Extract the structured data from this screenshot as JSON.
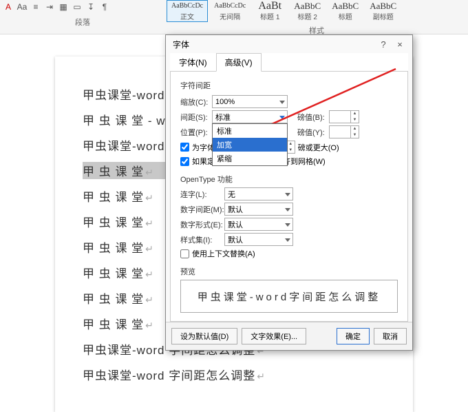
{
  "ribbon": {
    "paragraph_label": "段落",
    "styles_label": "样式",
    "styles": [
      {
        "preview": "AaBbCcDc",
        "name": "正文",
        "size": "10px"
      },
      {
        "preview": "AaBbCcDc",
        "name": "无间隔",
        "size": "10px"
      },
      {
        "preview": "AaBt",
        "name": "标题 1",
        "size": "16px"
      },
      {
        "preview": "AaBbC",
        "name": "标题 2",
        "size": "13px"
      },
      {
        "preview": "AaBbC",
        "name": "标题",
        "size": "13px"
      },
      {
        "preview": "AaBbC",
        "name": "副标题",
        "size": "13px"
      }
    ]
  },
  "document": {
    "lines": [
      "甲虫课堂-word 字间距怎么调整",
      "甲 虫 课 堂 - w o r d 字 间 距 怎 么 调 整",
      "甲虫课堂-word 字间距怎么调整",
      "甲 虫 课 堂",
      "甲 虫 课 堂",
      "甲 虫 课 堂",
      "甲 虫 课 堂",
      "甲 虫 课 堂",
      "甲 虫 课 堂",
      "甲 虫 课 堂",
      "甲虫课堂-word 字间距怎么调整",
      "甲虫课堂-word 字间距怎么调整"
    ],
    "selected_index": 3
  },
  "dialog": {
    "title": "字体",
    "help": "?",
    "close": "×",
    "tabs": {
      "font": "字体(N)",
      "advanced": "高级(V)"
    },
    "char_spacing_label": "字符间距",
    "scale_label": "缩放(C):",
    "scale_value": "100%",
    "spacing_label": "间距(S):",
    "spacing_value": "标准",
    "spacing_options": {
      "normal": "标准",
      "expanded": "加宽",
      "condensed": "紧缩"
    },
    "position_label": "位置(P):",
    "by_label_b": "磅值(B):",
    "by_label_y": "磅值(Y):",
    "kerning_label": "为字体调整字间距(K):",
    "kerning_unit": "磅或更大(O)",
    "grid_label": "如果定义了文档网格，则对齐到网格(W)",
    "opentype_label": "OpenType 功能",
    "ligatures_label": "连字(L):",
    "ligatures_value": "无",
    "numspacing_label": "数字间距(M):",
    "numspacing_value": "默认",
    "numforms_label": "数字形式(E):",
    "numforms_value": "默认",
    "stylistic_label": "样式集(I):",
    "stylistic_value": "默认",
    "context_label": "使用上下文替换(A)",
    "preview_label": "预览",
    "preview_text": "甲虫课堂-word字间距怎么调整",
    "btn_default": "设为默认值(D)",
    "btn_texteffects": "文字效果(E)...",
    "btn_ok": "确定",
    "btn_cancel": "取消"
  }
}
